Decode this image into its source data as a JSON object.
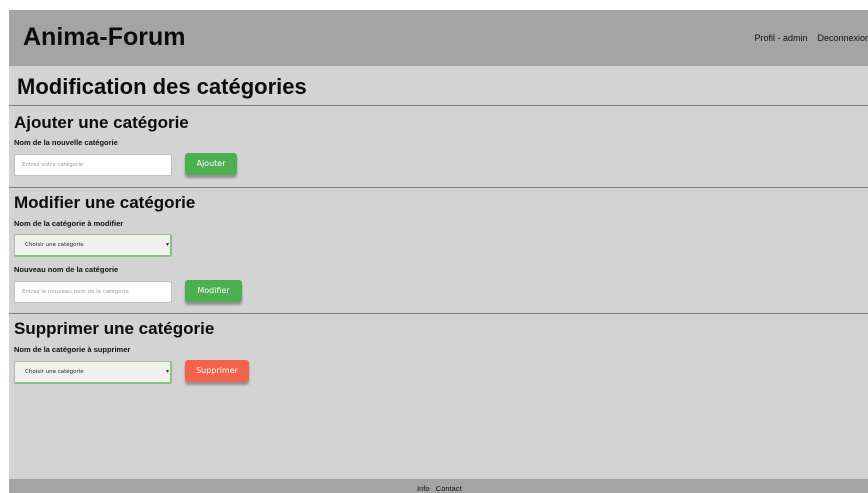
{
  "header": {
    "brand": "Anima-Forum",
    "nav": {
      "profile": "Profil - admin",
      "logout": "Deconnexion"
    }
  },
  "page_title": "Modification des catégories",
  "add": {
    "title": "Ajouter une catégorie",
    "label": "Nom de la nouvelle catégorie",
    "placeholder": "Entrez votre catégorie",
    "button": "Ajouter"
  },
  "edit": {
    "title": "Modifier une catégorie",
    "select_label": "Nom de la catégorie à modifier",
    "select_value": "Choisir une catégorie",
    "new_label": "Nouveau nom de la catégorie",
    "placeholder": "Entrez le nouveau nom de la catégorie",
    "button": "Modifier"
  },
  "delete": {
    "title": "Supprimer une catégorie",
    "select_label": "Nom de la catégorie à supprimer",
    "select_value": "Choisir une catégorie",
    "button": "Supprimer"
  },
  "footer": {
    "info": "Info",
    "contact": "Contact"
  },
  "colors": {
    "header_bg": "#a4a4a4",
    "page_bg": "#d3d3d3",
    "button_green": "#4caf50",
    "button_red": "#f5624b"
  }
}
